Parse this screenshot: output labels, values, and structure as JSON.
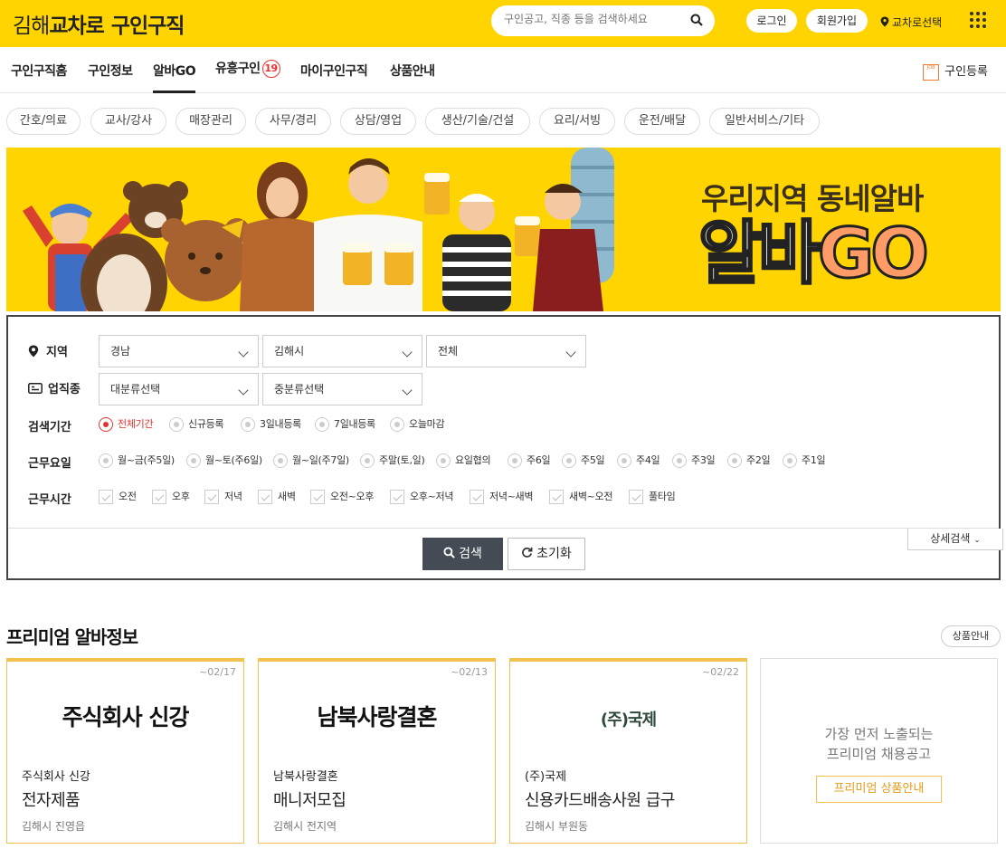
{
  "header": {
    "logo_part1": "김해",
    "logo_part2": "교차로",
    "logo_part3": "구인구직",
    "search_placeholder": "구인공고, 직종 등을 검색하세요",
    "login_label": "로그인",
    "signup_label": "회원가입",
    "location_label": "교차로선택"
  },
  "nav": {
    "items": [
      "구인구직홈",
      "구인정보",
      "알바GO",
      "유흥구인",
      "마이구인구직",
      "상품안내"
    ],
    "badge_count": "19",
    "active": "알바GO",
    "register_label": "구인등록",
    "register_icon_text": "JOB"
  },
  "categories": [
    "간호/의료",
    "교사/강사",
    "매장관리",
    "사무/경리",
    "상담/영업",
    "생산/기술/건설",
    "요리/서빙",
    "운전/배달",
    "일반서비스/기타"
  ],
  "banner": {
    "headline": "우리지역 동네알바",
    "title_part1": "알바",
    "title_part2": "GO"
  },
  "search_form": {
    "region_label": "지역",
    "region_selects": [
      "경남",
      "김해시",
      "전체"
    ],
    "industry_label": "업직종",
    "industry_selects": [
      "대분류선택",
      "중분류선택"
    ],
    "period_label": "검색기간",
    "period_options": [
      "전체기간",
      "신규등록",
      "3일내등록",
      "7일내등록",
      "오늘마감"
    ],
    "period_selected": "전체기간",
    "workday_label": "근무요일",
    "workday_options": [
      "월~금(주5일)",
      "월~토(주6일)",
      "월~일(주7일)",
      "주말(토,일)",
      "요일협의",
      "주6일",
      "주5일",
      "주4일",
      "주3일",
      "주2일",
      "주1일"
    ],
    "worktime_label": "근무시간",
    "worktime_options": [
      "오전",
      "오후",
      "저녁",
      "새벽",
      "오전~오후",
      "오후~저녁",
      "저녁~새벽",
      "새벽~오전",
      "풀타임"
    ],
    "search_button": "검색",
    "reset_button": "초기화",
    "detail_button": "상세검색"
  },
  "premium": {
    "title": "프리미엄 알바정보",
    "guide_button": "상품안내",
    "cards": [
      {
        "date": "~02/17",
        "logo_text": "주식회사 신강",
        "company": "주식회사 신강",
        "job": "전자제품",
        "area": "김해시 진영읍"
      },
      {
        "date": "~02/13",
        "logo_text": "남북사랑결혼",
        "company": "남북사랑결혼",
        "job": "매니저모집",
        "area": "김해시 전지역"
      },
      {
        "date": "~02/22",
        "logo_text": "(주)국제",
        "company": "(주)국제",
        "job": "신용카드배송사원 급구",
        "area": "김해시 부원동"
      }
    ],
    "empty_card": {
      "line1": "가장 먼저 노출되는",
      "line2": "프리미엄 채용공고",
      "cta": "프리미엄 상품안내"
    }
  },
  "colors": {
    "brand_yellow": "#ffd400",
    "accent_red": "#e6322d",
    "premium_border": "#f2c14e",
    "search_button": "#444b55"
  }
}
